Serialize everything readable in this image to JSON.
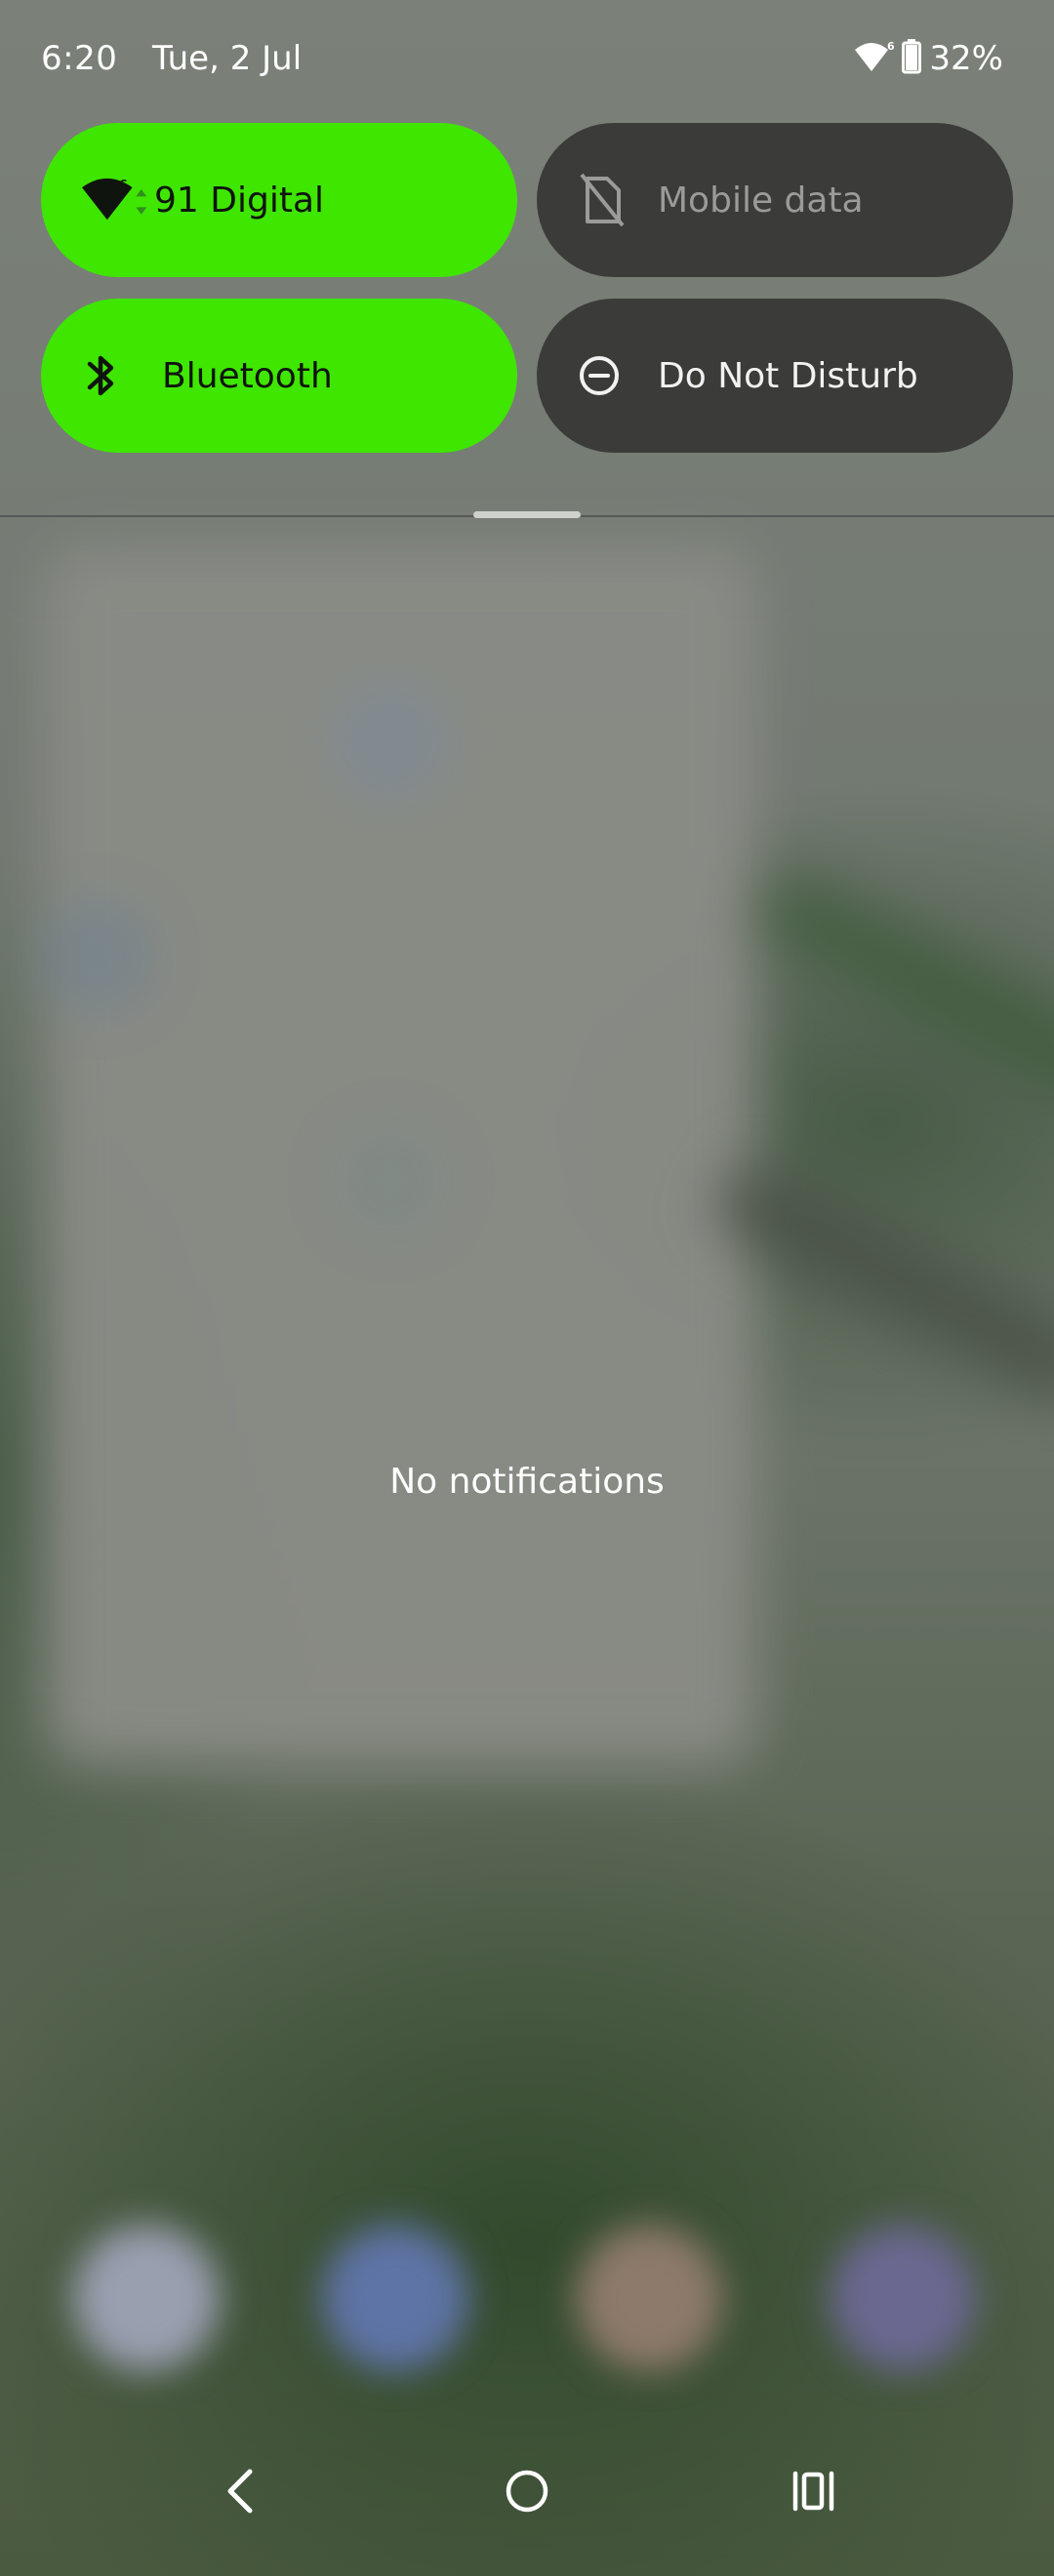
{
  "status_bar": {
    "time": "6:20",
    "date": "Tue, 2 Jul",
    "wifi_icon": "wifi-6-icon",
    "battery_icon": "battery-icon",
    "battery_percent": "32%",
    "battery_level": 0.32
  },
  "quick_settings": {
    "tiles": [
      {
        "label": "91 Digital",
        "icon": "wifi-6-icon",
        "state": "on"
      },
      {
        "label": "Mobile data",
        "icon": "mobile-data-off-icon",
        "state": "off"
      },
      {
        "label": "Bluetooth",
        "icon": "bluetooth-icon",
        "state": "on"
      },
      {
        "label": "Do Not Disturb",
        "icon": "do-not-disturb-icon",
        "state": "off"
      }
    ]
  },
  "notifications": {
    "empty_text": "No notifications"
  },
  "navigation": {
    "buttons": [
      {
        "name": "back",
        "icon": "back-chevron-icon"
      },
      {
        "name": "home",
        "icon": "home-circle-icon"
      },
      {
        "name": "recents",
        "icon": "recents-icon"
      }
    ]
  },
  "colors": {
    "tile_on": "#3fe600",
    "tile_off": "#3b3c3a",
    "text_on_dark": "#ffffff"
  }
}
